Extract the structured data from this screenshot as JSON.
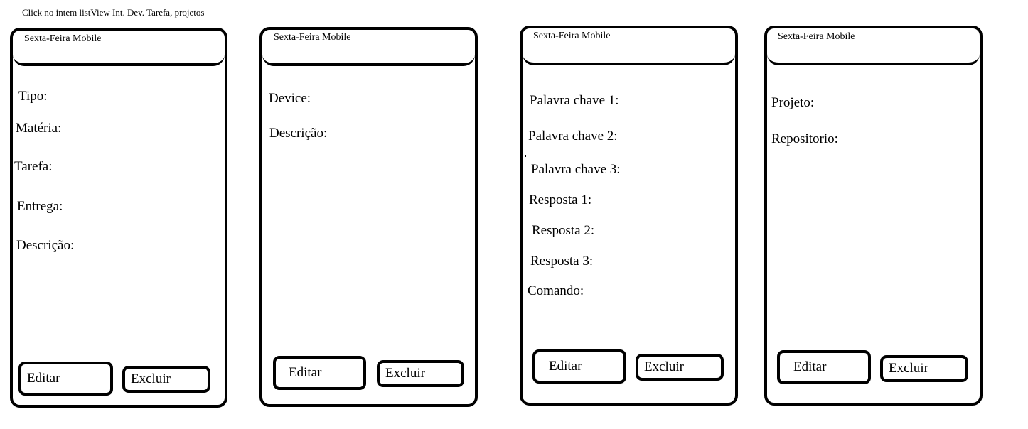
{
  "caption": "Click no intem listView Int. Dev. Tarefa, projetos",
  "screens": [
    {
      "title": "Sexta-Feira Mobile",
      "labels": [
        "Tipo:",
        "Matéria:",
        "Tarefa:",
        "Entrega:",
        "Descrição:"
      ],
      "edit_label": "Editar",
      "delete_label": "Excluir"
    },
    {
      "title": "Sexta-Feira Mobile",
      "labels": [
        "Device:",
        "Descrição:"
      ],
      "edit_label": "Editar",
      "delete_label": "Excluir"
    },
    {
      "title": "Sexta-Feira Mobile",
      "labels": [
        "Palavra chave 1:",
        "Palavra chave 2:",
        "Palavra chave 3:",
        "Resposta 1:",
        "Resposta 2:",
        "Resposta 3:",
        "Comando:"
      ],
      "edit_label": "Editar",
      "delete_label": "Excluir"
    },
    {
      "title": "Sexta-Feira Mobile",
      "labels": [
        "Projeto:",
        "Repositorio:"
      ],
      "edit_label": "Editar",
      "delete_label": "Excluir"
    }
  ]
}
